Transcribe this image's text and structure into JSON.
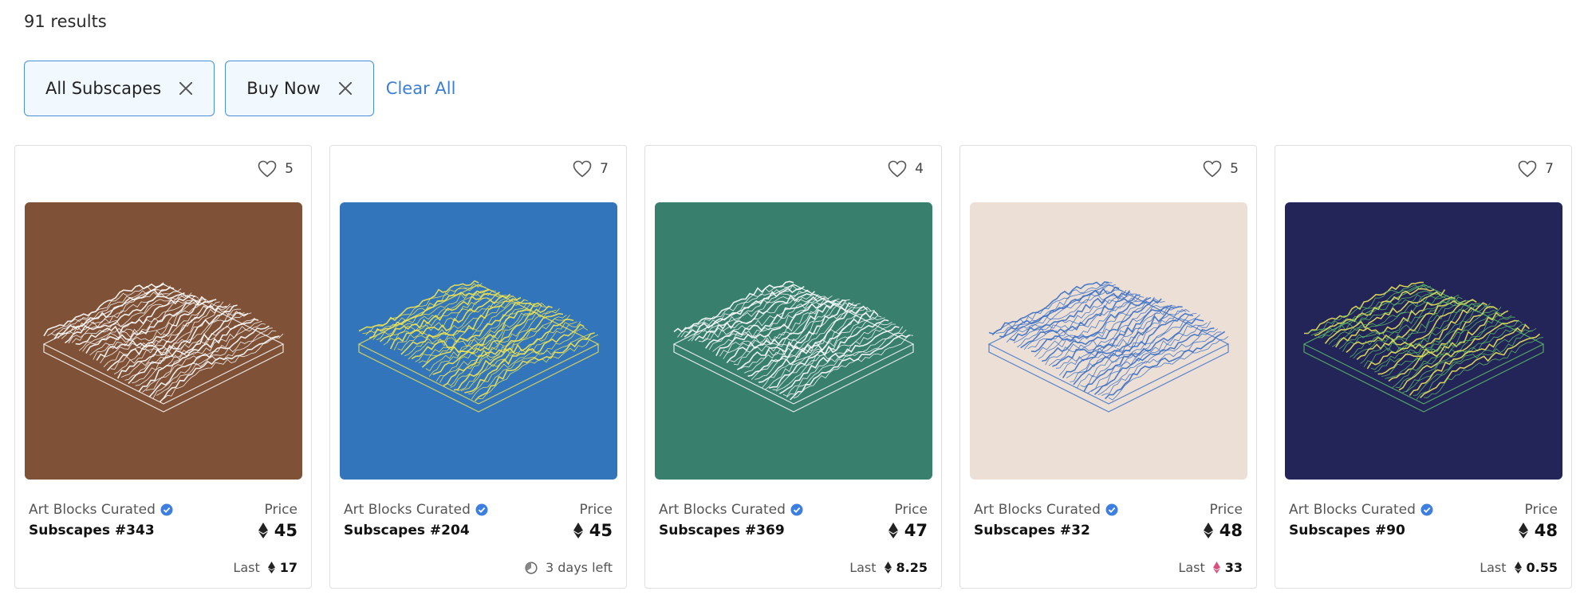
{
  "results": {
    "count_text": "91 results"
  },
  "filters": {
    "chips": [
      {
        "label": "All Subscapes"
      },
      {
        "label": "Buy Now"
      }
    ],
    "clear_label": "Clear All"
  },
  "cards": [
    {
      "likes": "5",
      "curator": "Art Blocks Curated",
      "title": "Subscapes #343",
      "price_label": "Price",
      "price": "45",
      "footer_label": "Last",
      "footer_value": "17",
      "footer_type": "last",
      "bg_color": "#7f5136",
      "line_color": "#ffffff",
      "accent_color": "#ffffff"
    },
    {
      "likes": "7",
      "curator": "Art Blocks Curated",
      "title": "Subscapes #204",
      "price_label": "Price",
      "price": "45",
      "footer_label": "3 days left",
      "footer_value": "",
      "footer_type": "timer",
      "bg_color": "#3375bb",
      "line_color": "#f2e54e",
      "accent_color": "#f2e54e"
    },
    {
      "likes": "4",
      "curator": "Art Blocks Curated",
      "title": "Subscapes #369",
      "price_label": "Price",
      "price": "47",
      "footer_label": "Last",
      "footer_value": "8.25",
      "footer_type": "last",
      "bg_color": "#387f6e",
      "line_color": "#ffffff",
      "accent_color": "#ffffff"
    },
    {
      "likes": "5",
      "curator": "Art Blocks Curated",
      "title": "Subscapes #32",
      "price_label": "Price",
      "price": "48",
      "footer_label": "Last",
      "footer_value": "33",
      "footer_type": "last",
      "bg_color": "#ecdfd6",
      "line_color": "#3b6fc5",
      "accent_color": "#3b6fc5"
    },
    {
      "likes": "7",
      "curator": "Art Blocks Curated",
      "title": "Subscapes #90",
      "price_label": "Price",
      "price": "48",
      "footer_label": "Last",
      "footer_value": "0.55",
      "footer_type": "last",
      "bg_color": "#232458",
      "line_color": "#5dbf6a",
      "accent_color": "#e7e25a"
    }
  ],
  "colors": {
    "accent": "#3b7fd4",
    "chip_border": "#4a90d9",
    "chip_bg": "#f2f9fe"
  }
}
